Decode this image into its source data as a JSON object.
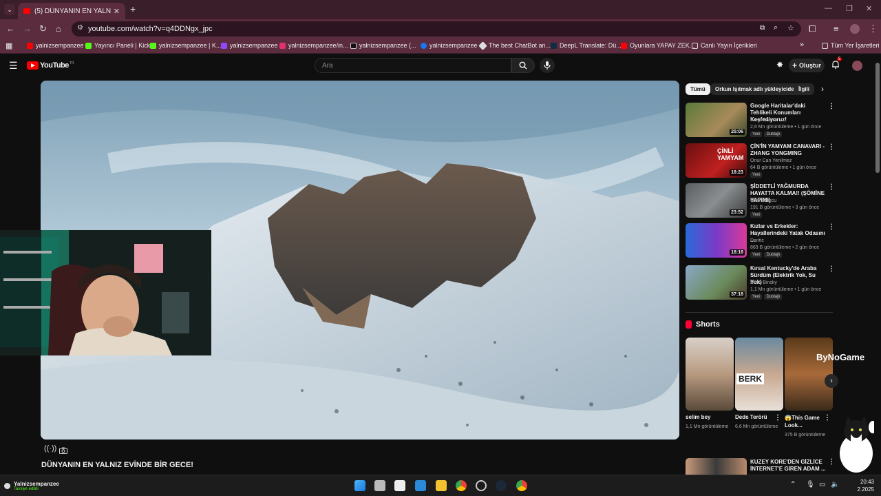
{
  "browser": {
    "tab_title": "(5) DÜNYANIN EN YALNIZ EVİN",
    "url": "youtube.com/watch?v=q4DDNgx_jpc",
    "bookmarks": [
      "yalnizsempanzee",
      "Yayıncı Paneli | Kick",
      "yalnizsempanzee | K...",
      "yalnizsempanzee",
      "yalnizsempanzee/in...",
      "yalnizsempanzee (...",
      "yalnizsempanzee",
      "The best ChatBot an...",
      "DeepL Translate: Dü...",
      "Oyunlara YAPAY ZEK...",
      "Canlı Yayın İçerikleri"
    ],
    "all_bookmarks": "Tüm Yer İşaretleri",
    "more_bookmarks": "»"
  },
  "youtube": {
    "logo_text": "YouTube",
    "logo_region": "TR",
    "search_placeholder": "Ara",
    "create_label": "Oluştur",
    "notification_count": "5"
  },
  "video": {
    "title": "DÜNYANIN EN YALNIZ EVİNDE BİR GECE!"
  },
  "chips": [
    "Tümü",
    "Orkun Işıtmak adlı yükleyiciden",
    "İlgili"
  ],
  "recommendations": [
    {
      "title": "Google Haritalar'daki Tehlikeli Konumları Keşfediyoruz!",
      "channel": "Brent Rivera",
      "meta": "2,6 Mn görüntüleme • 1 gün önce",
      "duration": "25:06",
      "badges": [
        "Yeni",
        "Dublajlı"
      ]
    },
    {
      "title": "ÇİN'İN YAMYAM CANAVARI - ZHANG YONGMING",
      "channel": "Onur Can Yenilmez",
      "meta": "64 B görüntüleme • 1 gün önce",
      "duration": "18:23",
      "badges": [
        "Yeni"
      ]
    },
    {
      "title": "ŞİDDETLİ YAĞMURDA HAYATTA KALMA!! (ŞÖMİNE YAPIMI)",
      "channel": "Ozan Kuşcu",
      "meta": "191 B görüntüleme • 3 gün önce",
      "duration": "23:52",
      "badges": [
        "Yeni"
      ]
    },
    {
      "title": "Kızlar vs Erkekler: Hayallerindeki Yatak Odasını ...",
      "channel": "Dantic",
      "meta": "869 B görüntüleme • 2 gün önce",
      "duration": "18:18",
      "badges": [
        "Yeni",
        "Dublajlı"
      ]
    },
    {
      "title": "Kırsal Kentucky'de Araba Sürdüm (Elektrik Yok, Su Yok)",
      "channel": "Drew Binsky",
      "meta": "1,1 Mn görüntüleme • 1 gün önce",
      "duration": "37:18",
      "badges": [
        "Yeni",
        "Dublajlı"
      ]
    }
  ],
  "shorts": {
    "heading": "Shorts",
    "items": [
      {
        "title": "selim bey",
        "views": "1,1 Mn görüntüleme"
      },
      {
        "title": "Dede Terörü",
        "views": "6,6 Mn görüntüleme"
      },
      {
        "title": "😱This Game Look...",
        "views": "375 B görüntüleme"
      }
    ],
    "overlay_text": "ByNoGame",
    "thumb2_text": "BERK"
  },
  "next_rec_title": "KUZEY KORE'DEN GİZLİCE İNTERNET'E GİREN ADAM ...",
  "stream": {
    "streamer": "Yalnizsempanzee",
    "status": "Tavsiye edildi"
  },
  "taskbar": {
    "time": "20:43",
    "date": "2.2025"
  },
  "colors": {
    "tab_bg": "#3a1e2a",
    "toolbar_bg": "#5a2c3e",
    "yt_bg": "#0f0f0f",
    "yt_red": "#ff0000",
    "webcam_green": "#1ec8a0"
  }
}
